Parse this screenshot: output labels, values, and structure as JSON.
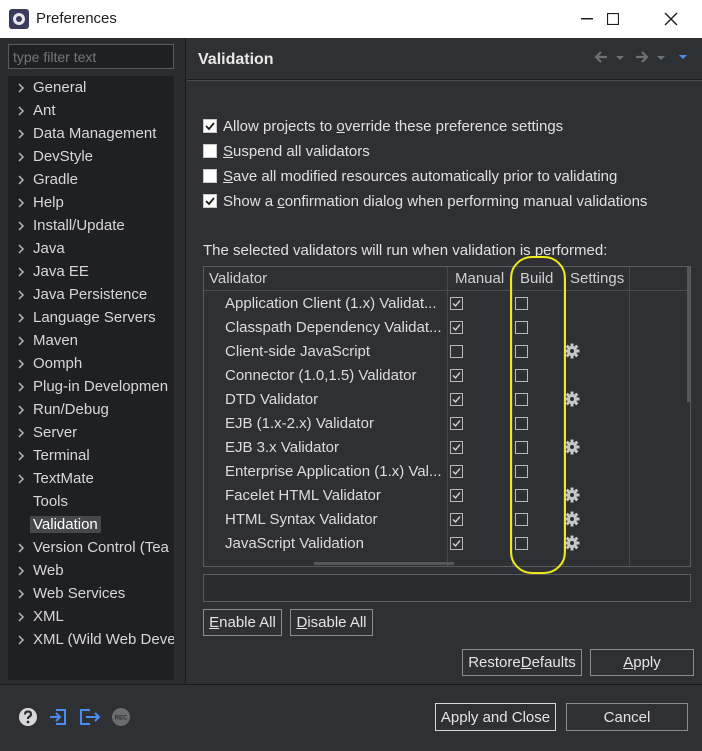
{
  "window": {
    "title": "Preferences"
  },
  "filter": {
    "placeholder": "type filter text"
  },
  "tree": {
    "items": [
      {
        "label": "General",
        "expandable": true
      },
      {
        "label": "Ant",
        "expandable": true
      },
      {
        "label": "Data Management",
        "expandable": true
      },
      {
        "label": "DevStyle",
        "expandable": true
      },
      {
        "label": "Gradle",
        "expandable": true
      },
      {
        "label": "Help",
        "expandable": true
      },
      {
        "label": "Install/Update",
        "expandable": true
      },
      {
        "label": "Java",
        "expandable": true
      },
      {
        "label": "Java EE",
        "expandable": true
      },
      {
        "label": "Java Persistence",
        "expandable": true
      },
      {
        "label": "Language Servers",
        "expandable": true
      },
      {
        "label": "Maven",
        "expandable": true
      },
      {
        "label": "Oomph",
        "expandable": true
      },
      {
        "label": "Plug-in Developmen",
        "expandable": true
      },
      {
        "label": "Run/Debug",
        "expandable": true
      },
      {
        "label": "Server",
        "expandable": true
      },
      {
        "label": "Terminal",
        "expandable": true
      },
      {
        "label": "TextMate",
        "expandable": true
      },
      {
        "label": "Tools",
        "expandable": false
      },
      {
        "label": "Validation",
        "expandable": false,
        "selected": true
      },
      {
        "label": "Version Control (Tea",
        "expandable": true
      },
      {
        "label": "Web",
        "expandable": true
      },
      {
        "label": "Web Services",
        "expandable": true
      },
      {
        "label": "XML",
        "expandable": true
      },
      {
        "label": "XML (Wild Web Deve",
        "expandable": true
      }
    ]
  },
  "page": {
    "title": "Validation"
  },
  "options": {
    "allow_override": {
      "pre": "Allow projects to ",
      "u": "o",
      "post": "verride these preference settings",
      "checked": true
    },
    "suspend": {
      "pre": "",
      "u": "S",
      "post": "uspend all validators",
      "checked": false
    },
    "save_all": {
      "pre": "",
      "u": "S",
      "post": "ave all modified resources automatically prior to validating",
      "checked": false
    },
    "confirm": {
      "pre": "Show a ",
      "u": "c",
      "post": "onfirmation dialog when performing manual validations",
      "checked": true
    }
  },
  "description": "The selected validators will run when validation is performed:",
  "table": {
    "headers": {
      "validator": "Validator",
      "manual": "Manual",
      "build": "Build",
      "settings": "Settings"
    },
    "rows": [
      {
        "name": "Application Client (1.x) Validat...",
        "manual": true,
        "build": false,
        "settings": false
      },
      {
        "name": "Classpath Dependency Validat...",
        "manual": true,
        "build": false,
        "settings": false
      },
      {
        "name": "Client-side JavaScript",
        "manual": false,
        "build": false,
        "settings": true
      },
      {
        "name": "Connector (1.0,1.5) Validator",
        "manual": true,
        "build": false,
        "settings": false
      },
      {
        "name": "DTD Validator",
        "manual": true,
        "build": false,
        "settings": true
      },
      {
        "name": "EJB (1.x-2.x) Validator",
        "manual": true,
        "build": false,
        "settings": false
      },
      {
        "name": "EJB 3.x Validator",
        "manual": true,
        "build": false,
        "settings": true
      },
      {
        "name": "Enterprise Application (1.x) Val...",
        "manual": true,
        "build": false,
        "settings": false
      },
      {
        "name": "Facelet HTML Validator",
        "manual": true,
        "build": false,
        "settings": true
      },
      {
        "name": "HTML Syntax Validator",
        "manual": true,
        "build": false,
        "settings": true
      },
      {
        "name": "JavaScript Validation",
        "manual": true,
        "build": false,
        "settings": true
      }
    ]
  },
  "buttons": {
    "enable_all": {
      "u": "E",
      "rest": "nable All"
    },
    "disable_all": {
      "u": "D",
      "rest": "isable All"
    },
    "restore_defaults": {
      "pre": "Restore ",
      "u": "D",
      "post": "efaults"
    },
    "apply": {
      "u": "A",
      "rest": "pply"
    },
    "apply_and_close": "Apply and Close",
    "cancel": "Cancel"
  },
  "colors": {
    "background": "#2f3033",
    "tree_bg": "#1f2023",
    "highlight": "#f0ea1c",
    "accent_blue": "#4a8cf0"
  }
}
